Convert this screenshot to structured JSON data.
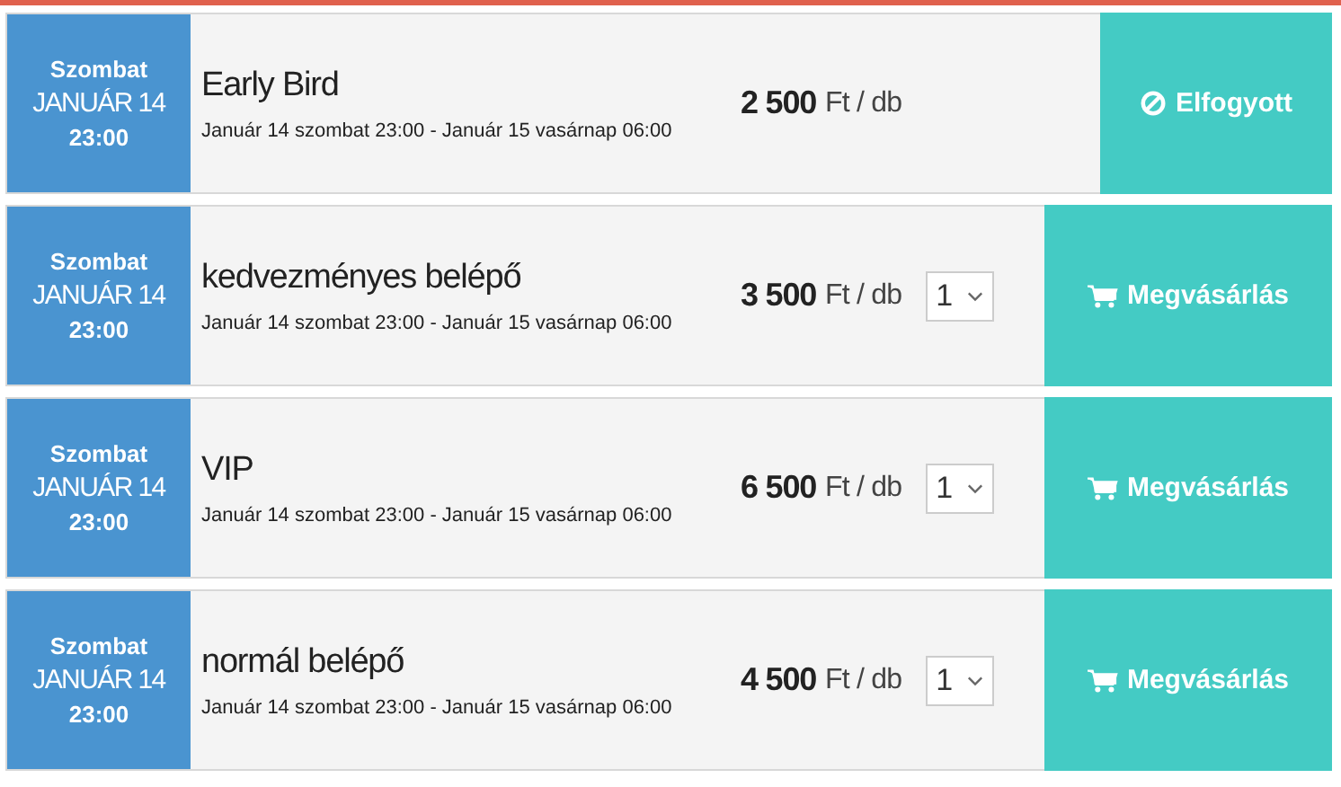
{
  "tickets": [
    {
      "day": "Szombat",
      "date": "JANUÁR 14",
      "time": "23:00",
      "name": "Early Bird",
      "period": "Január 14 szombat 23:00 - Január 15 vasárnap 06:00",
      "price": "2 500",
      "unit": "Ft / db",
      "kind": "sold_out",
      "button": "Elfogyott"
    },
    {
      "day": "Szombat",
      "date": "JANUÁR 14",
      "time": "23:00",
      "name": "kedvezményes belépő",
      "period": "Január 14 szombat 23:00 - Január 15 vasárnap 06:00",
      "price": "3 500",
      "unit": "Ft / db",
      "kind": "buy",
      "quantity": "1",
      "button": "Megvásárlás"
    },
    {
      "day": "Szombat",
      "date": "JANUÁR 14",
      "time": "23:00",
      "name": "VIP",
      "period": "Január 14 szombat 23:00 - Január 15 vasárnap 06:00",
      "price": "6 500",
      "unit": "Ft / db",
      "kind": "buy",
      "quantity": "1",
      "button": "Megvásárlás"
    },
    {
      "day": "Szombat",
      "date": "JANUÁR 14",
      "time": "23:00",
      "name": "normál belépő",
      "period": "Január 14 szombat 23:00 - Január 15 vasárnap 06:00",
      "price": "4 500",
      "unit": "Ft / db",
      "kind": "buy",
      "quantity": "1",
      "button": "Megvásárlás"
    }
  ]
}
